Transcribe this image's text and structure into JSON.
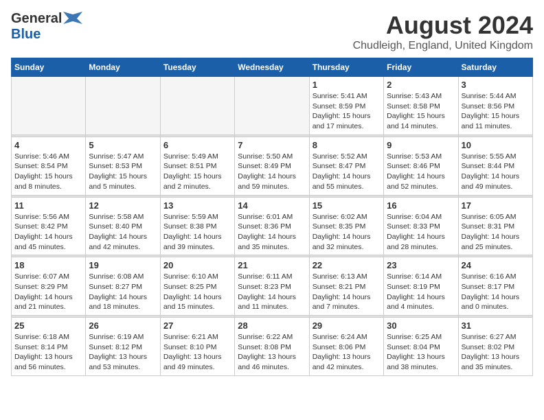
{
  "header": {
    "logo_general": "General",
    "logo_blue": "Blue",
    "month_year": "August 2024",
    "location": "Chudleigh, England, United Kingdom"
  },
  "weekdays": [
    "Sunday",
    "Monday",
    "Tuesday",
    "Wednesday",
    "Thursday",
    "Friday",
    "Saturday"
  ],
  "weeks": [
    [
      {
        "day": "",
        "sunrise": "",
        "sunset": "",
        "daylight": "",
        "empty": true
      },
      {
        "day": "",
        "sunrise": "",
        "sunset": "",
        "daylight": "",
        "empty": true
      },
      {
        "day": "",
        "sunrise": "",
        "sunset": "",
        "daylight": "",
        "empty": true
      },
      {
        "day": "",
        "sunrise": "",
        "sunset": "",
        "daylight": "",
        "empty": true
      },
      {
        "day": "1",
        "sunrise": "5:41 AM",
        "sunset": "8:59 PM",
        "daylight": "15 hours and 17 minutes."
      },
      {
        "day": "2",
        "sunrise": "5:43 AM",
        "sunset": "8:58 PM",
        "daylight": "15 hours and 14 minutes."
      },
      {
        "day": "3",
        "sunrise": "5:44 AM",
        "sunset": "8:56 PM",
        "daylight": "15 hours and 11 minutes."
      }
    ],
    [
      {
        "day": "4",
        "sunrise": "5:46 AM",
        "sunset": "8:54 PM",
        "daylight": "15 hours and 8 minutes."
      },
      {
        "day": "5",
        "sunrise": "5:47 AM",
        "sunset": "8:53 PM",
        "daylight": "15 hours and 5 minutes."
      },
      {
        "day": "6",
        "sunrise": "5:49 AM",
        "sunset": "8:51 PM",
        "daylight": "15 hours and 2 minutes."
      },
      {
        "day": "7",
        "sunrise": "5:50 AM",
        "sunset": "8:49 PM",
        "daylight": "14 hours and 59 minutes."
      },
      {
        "day": "8",
        "sunrise": "5:52 AM",
        "sunset": "8:47 PM",
        "daylight": "14 hours and 55 minutes."
      },
      {
        "day": "9",
        "sunrise": "5:53 AM",
        "sunset": "8:46 PM",
        "daylight": "14 hours and 52 minutes."
      },
      {
        "day": "10",
        "sunrise": "5:55 AM",
        "sunset": "8:44 PM",
        "daylight": "14 hours and 49 minutes."
      }
    ],
    [
      {
        "day": "11",
        "sunrise": "5:56 AM",
        "sunset": "8:42 PM",
        "daylight": "14 hours and 45 minutes."
      },
      {
        "day": "12",
        "sunrise": "5:58 AM",
        "sunset": "8:40 PM",
        "daylight": "14 hours and 42 minutes."
      },
      {
        "day": "13",
        "sunrise": "5:59 AM",
        "sunset": "8:38 PM",
        "daylight": "14 hours and 39 minutes."
      },
      {
        "day": "14",
        "sunrise": "6:01 AM",
        "sunset": "8:36 PM",
        "daylight": "14 hours and 35 minutes."
      },
      {
        "day": "15",
        "sunrise": "6:02 AM",
        "sunset": "8:35 PM",
        "daylight": "14 hours and 32 minutes."
      },
      {
        "day": "16",
        "sunrise": "6:04 AM",
        "sunset": "8:33 PM",
        "daylight": "14 hours and 28 minutes."
      },
      {
        "day": "17",
        "sunrise": "6:05 AM",
        "sunset": "8:31 PM",
        "daylight": "14 hours and 25 minutes."
      }
    ],
    [
      {
        "day": "18",
        "sunrise": "6:07 AM",
        "sunset": "8:29 PM",
        "daylight": "14 hours and 21 minutes."
      },
      {
        "day": "19",
        "sunrise": "6:08 AM",
        "sunset": "8:27 PM",
        "daylight": "14 hours and 18 minutes."
      },
      {
        "day": "20",
        "sunrise": "6:10 AM",
        "sunset": "8:25 PM",
        "daylight": "14 hours and 15 minutes."
      },
      {
        "day": "21",
        "sunrise": "6:11 AM",
        "sunset": "8:23 PM",
        "daylight": "14 hours and 11 minutes."
      },
      {
        "day": "22",
        "sunrise": "6:13 AM",
        "sunset": "8:21 PM",
        "daylight": "14 hours and 7 minutes."
      },
      {
        "day": "23",
        "sunrise": "6:14 AM",
        "sunset": "8:19 PM",
        "daylight": "14 hours and 4 minutes."
      },
      {
        "day": "24",
        "sunrise": "6:16 AM",
        "sunset": "8:17 PM",
        "daylight": "14 hours and 0 minutes."
      }
    ],
    [
      {
        "day": "25",
        "sunrise": "6:18 AM",
        "sunset": "8:14 PM",
        "daylight": "13 hours and 56 minutes."
      },
      {
        "day": "26",
        "sunrise": "6:19 AM",
        "sunset": "8:12 PM",
        "daylight": "13 hours and 53 minutes."
      },
      {
        "day": "27",
        "sunrise": "6:21 AM",
        "sunset": "8:10 PM",
        "daylight": "13 hours and 49 minutes."
      },
      {
        "day": "28",
        "sunrise": "6:22 AM",
        "sunset": "8:08 PM",
        "daylight": "13 hours and 46 minutes."
      },
      {
        "day": "29",
        "sunrise": "6:24 AM",
        "sunset": "8:06 PM",
        "daylight": "13 hours and 42 minutes."
      },
      {
        "day": "30",
        "sunrise": "6:25 AM",
        "sunset": "8:04 PM",
        "daylight": "13 hours and 38 minutes."
      },
      {
        "day": "31",
        "sunrise": "6:27 AM",
        "sunset": "8:02 PM",
        "daylight": "13 hours and 35 minutes."
      }
    ]
  ],
  "labels": {
    "sunrise_prefix": "Sunrise: ",
    "sunset_prefix": "Sunset: ",
    "daylight_prefix": "Daylight: "
  }
}
